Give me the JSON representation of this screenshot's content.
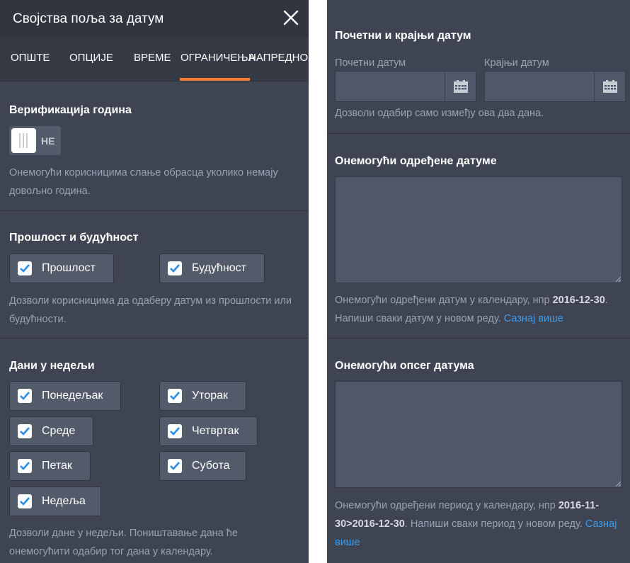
{
  "header": {
    "title": "Својства поља за датум"
  },
  "tabs": [
    {
      "label": "ОПШТЕ"
    },
    {
      "label": "ОПЦИЈЕ"
    },
    {
      "label": "ВРЕМЕ"
    },
    {
      "label": "ОГРАНИЧЕЊА",
      "active": true
    },
    {
      "label": "НАПРЕДНО"
    }
  ],
  "accent_color": "#ff7a32",
  "age_verification": {
    "title": "Верификација година",
    "toggle_label": "НЕ",
    "description": "Онемогући корисницима слање обрасца уколико немају довољно година."
  },
  "past_future": {
    "title": "Прошлост и будућност",
    "options": [
      {
        "label": "Прошлост",
        "checked": true
      },
      {
        "label": "Будућност",
        "checked": true
      }
    ],
    "description": "Дозволи корисницима да одаберу датум из прошлости или будућности."
  },
  "weekdays": {
    "title": "Дани у недељи",
    "options": [
      {
        "label": "Понедељак",
        "checked": true
      },
      {
        "label": "Уторак",
        "checked": true
      },
      {
        "label": "Среде",
        "checked": true
      },
      {
        "label": "Четвртак",
        "checked": true
      },
      {
        "label": "Петак",
        "checked": true
      },
      {
        "label": "Субота",
        "checked": true
      },
      {
        "label": "Недеља",
        "checked": true
      }
    ],
    "description": "Дозволи дане у недељи. Поништавање дана ће онемогућити одабир тог дана у календару."
  },
  "date_range": {
    "title": "Почетни и крајњи датум",
    "start_label": "Почетни датум",
    "start_value": "",
    "end_label": "Крајњи датум",
    "end_value": "",
    "description": "Дозволи одабир само између ова два дана."
  },
  "disable_dates": {
    "title": "Онемогући одређене датуме",
    "value": "",
    "desc_pre": "Онемогући одређени датум у календару, нпр",
    "desc_example": "2016-12-30",
    "desc_post": ". Напиши сваки датум у новом реду.",
    "link": "Сазнај више"
  },
  "disable_range": {
    "title": "Онемогући опсег датума",
    "value": "",
    "desc_pre": "Онемогући одређени период у календару, нпр",
    "desc_example": "2016-11-30>2016-12-30",
    "desc_post": ". Напиши сваки период у новом реду.",
    "link": "Сазнај више"
  }
}
